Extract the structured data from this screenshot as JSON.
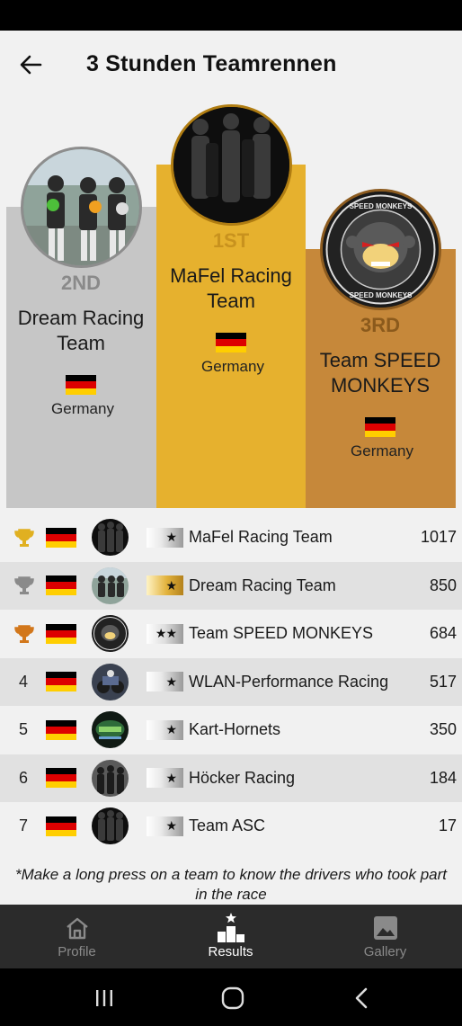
{
  "header": {
    "title": "3 Stunden Teamrennen"
  },
  "podium": {
    "first": {
      "rank": "1ST",
      "team": "MaFel Racing Team",
      "country": "Germany"
    },
    "second": {
      "rank": "2ND",
      "team": "Dream Racing Team",
      "country": "Germany"
    },
    "third": {
      "rank": "3RD",
      "team": "Team SPEED MONKEYS",
      "country": "Germany"
    }
  },
  "results": [
    {
      "position": "",
      "trophy": "gold-trophy-icon",
      "team": "MaFel Racing Team",
      "points": "1017",
      "level": "★"
    },
    {
      "position": "",
      "trophy": "silver-trophy-icon",
      "team": "Dream Racing Team",
      "points": "850",
      "level": "★"
    },
    {
      "position": "",
      "trophy": "bronze-trophy-icon",
      "team": "Team SPEED MONKEYS",
      "points": "684",
      "level": "★★"
    },
    {
      "position": "4",
      "team": "WLAN-Performance Racing",
      "points": "517",
      "level": "★"
    },
    {
      "position": "5",
      "team": "Kart-Hornets",
      "points": "350",
      "level": "★"
    },
    {
      "position": "6",
      "team": "Höcker Racing",
      "points": "184",
      "level": "★"
    },
    {
      "position": "7",
      "team": "Team ASC",
      "points": "17",
      "level": "★"
    }
  ],
  "hint": "*Make a long press on a team to know the drivers who took part in the race",
  "nav": {
    "profile": "Profile",
    "results": "Results",
    "gallery": "Gallery"
  },
  "colors": {
    "gold": "#e6b12e",
    "silver": "#c6c6c6",
    "bronze": "#c6883a",
    "navbar": "#2b2b2b"
  }
}
